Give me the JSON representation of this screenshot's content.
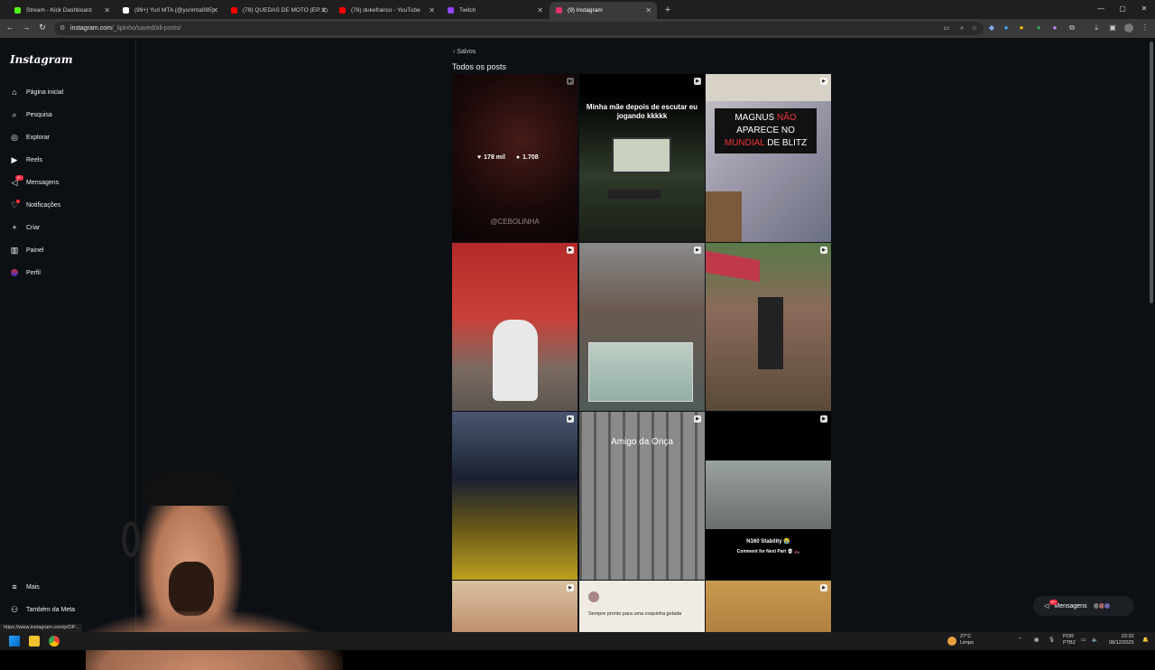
{
  "browser": {
    "tabs": [
      {
        "label": "Stream - Kick Dashboard",
        "color": "#53fc18"
      },
      {
        "label": "(99+) Yuri MTA (@yurimta085)",
        "color": "#ffffff"
      },
      {
        "label": "(78) QUEDAS DE MOTO (EP. 1)",
        "color": "#ff0000"
      },
      {
        "label": "(78) dukefranco - YouTube",
        "color": "#ff0000"
      },
      {
        "label": "Twitch",
        "color": "#9146ff"
      },
      {
        "label": "(9) Instagram",
        "color": "#e1306c"
      }
    ],
    "url_host": "instagram.com",
    "url_path": "/_lipinho/saved/all-posts/",
    "status_url": "https://www.instagram.com/p/DP..."
  },
  "sidebar": {
    "logo": "Instagram",
    "items": [
      {
        "label": "Página inicial",
        "icon": "home-icon"
      },
      {
        "label": "Pesquisa",
        "icon": "search-icon"
      },
      {
        "label": "Explorar",
        "icon": "compass-icon"
      },
      {
        "label": "Reels",
        "icon": "reels-icon"
      },
      {
        "label": "Mensagens",
        "icon": "messenger-icon",
        "badge": "9+"
      },
      {
        "label": "Notificações",
        "icon": "heart-icon"
      },
      {
        "label": "Criar",
        "icon": "plus-icon"
      },
      {
        "label": "Painel",
        "icon": "chart-icon"
      },
      {
        "label": "Perfil",
        "icon": "avatar-icon"
      }
    ],
    "bottom": [
      {
        "label": "Mais",
        "icon": "menu-icon"
      },
      {
        "label": "Também da Meta",
        "icon": "meta-icon"
      }
    ]
  },
  "main": {
    "breadcrumb": "Salvos",
    "title": "Todos os posts",
    "hover_stats": {
      "likes": "178 mil",
      "comments": "1.708"
    },
    "posts": [
      {
        "caption": "",
        "overlay_text": "@CEBOLINHA"
      },
      {
        "caption": "Minha mãe depois de escutar eu jogando kkkkk"
      },
      {
        "caption_parts": [
          "MAGNUS ",
          "NÃO",
          " APARECE NO ",
          "MUNDIAL",
          " DE BLITZ"
        ]
      },
      {
        "caption": ""
      },
      {
        "caption": ""
      },
      {
        "caption": ""
      },
      {
        "caption": ""
      },
      {
        "caption": "Amigo da Onça"
      },
      {
        "caption": "N160 Stability 😭",
        "sub": "Comment for Next Part 💀 🏍️"
      },
      {
        "caption": ""
      },
      {
        "caption": "Sempre pronto para uma coquinha gelada"
      },
      {
        "caption": ""
      }
    ]
  },
  "floating": {
    "label": "Mensagens",
    "badge": "9+"
  },
  "taskbar": {
    "weather_temp": "27°C",
    "weather_desc": "Limpo",
    "lang": "POR",
    "layout": "PTB2",
    "time": "22:32",
    "date": "08/12/2025"
  }
}
